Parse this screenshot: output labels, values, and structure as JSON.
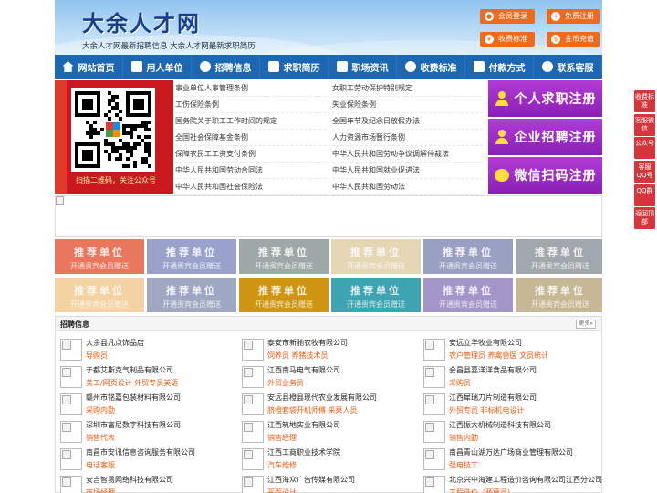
{
  "header": {
    "site_title": "大余人才网",
    "slogan": "大余人才网最新招聘信息    大余人才网最新求职简历",
    "buttons": {
      "login": "会员登录",
      "register": "免费注册",
      "fees": "收费标准",
      "coin": "金币充值"
    }
  },
  "nav": [
    {
      "label": "网站首页",
      "icon": "home-icon"
    },
    {
      "label": "用人单位",
      "icon": "building-icon"
    },
    {
      "label": "招聘信息",
      "icon": "broadcast-icon"
    },
    {
      "label": "求职简历",
      "icon": "resume-icon"
    },
    {
      "label": "职场资讯",
      "icon": "news-icon"
    },
    {
      "label": "收费标准",
      "icon": "coin-icon"
    },
    {
      "label": "付款方式",
      "icon": "card-icon"
    },
    {
      "label": "联系客服",
      "icon": "phone-icon"
    }
  ],
  "qr": {
    "caption": "扫描二维码，关注公众号"
  },
  "laws": [
    [
      "事业单位人事管理条例",
      "女职工劳动保护特别规定"
    ],
    [
      "工伤保险条例",
      "失业保险条例"
    ],
    [
      "国务院关于职工工作时间的规定",
      "全国年节及纪念日放假办法"
    ],
    [
      "全国社会保障基金条例",
      "人力资源市场暂行条例"
    ],
    [
      "保障农民工工资支付条例",
      "中华人民共和国劳动争议调解仲裁法"
    ],
    [
      "中华人民共和国劳动合同法",
      "中华人民共和国就业促进法"
    ],
    [
      "中华人民共和国社会保险法",
      "中华人民共和国劳动法"
    ]
  ],
  "register": {
    "personal": "个人求职注册",
    "company": "企业招聘注册",
    "wechat": "微信扫码注册"
  },
  "recommended": {
    "title": "推荐单位",
    "subtitle": "开通贵宾会员赠送",
    "colors": [
      "#e9775e",
      "#9aa2cb",
      "#9ea8a6",
      "#e5d6b6",
      "#9aa0c1",
      "#a2a7ad",
      "#f4d3a2",
      "#9fa8c2",
      "#cf9614",
      "#3fa4b2",
      "#a395c8",
      "#c6b795"
    ]
  },
  "jobs": {
    "title": "招聘信息",
    "more": "更多»",
    "rows": [
      [
        {
          "company": "大余县凡点饰品店",
          "positions": "导购员"
        },
        {
          "company": "泰安市新驰农牧有限公司",
          "positions": "饲养员 养猪技术员"
        },
        {
          "company": "安远立华牧业有限公司",
          "positions": "农户管理员 养禽兽医 文员统计"
        }
      ],
      [
        {
          "company": "于都艾斯克气制品有限公司",
          "positions": "美工/网页设计 外贸专员英语"
        },
        {
          "company": "江西南马电气有限公司",
          "positions": "外贸业务员"
        },
        {
          "company": "会昌县嘉洋洋食品有限公司",
          "positions": "采购员"
        }
      ],
      [
        {
          "company": "赣州市铭嘉包装材料有限公司",
          "positions": "采购内勤"
        },
        {
          "company": "安远县橙县现代农业发展有限公司",
          "positions": "脐橙套袋开机师傅 采果人员"
        },
        {
          "company": "江西犀瑞刀片制造有限公司",
          "positions": "外贸专员 非标机电设计"
        }
      ],
      [
        {
          "company": "深圳市富尼数字科技有限公司",
          "positions": "销售代表"
        },
        {
          "company": "江西筑地实业有限公司",
          "positions": "销售经理"
        },
        {
          "company": "江西振大机械制造科技有限公司",
          "positions": "销售内勤"
        }
      ],
      [
        {
          "company": "南昌市安讯信息咨询服务有限公司",
          "positions": "电话客服"
        },
        {
          "company": "江西工商职业技术学院",
          "positions": "汽车维修"
        },
        {
          "company": "南昌青山湖万达广场商业管理有限公司",
          "positions": "强电技工"
        }
      ],
      [
        {
          "company": "安吉智易网络科技有限公司",
          "positions": "市场经理"
        },
        {
          "company": "江西海众广告传媒有限公司",
          "positions": "平面设计"
        },
        {
          "company": "北京兴中海建工程造价咨询有限公司江西分公司",
          "positions": "工程造价（预算员）"
        }
      ]
    ]
  },
  "sidefloat": [
    "收费标准",
    "客服微信",
    "公众号",
    "客服QQ号",
    "QQ群",
    "返回顶部"
  ]
}
